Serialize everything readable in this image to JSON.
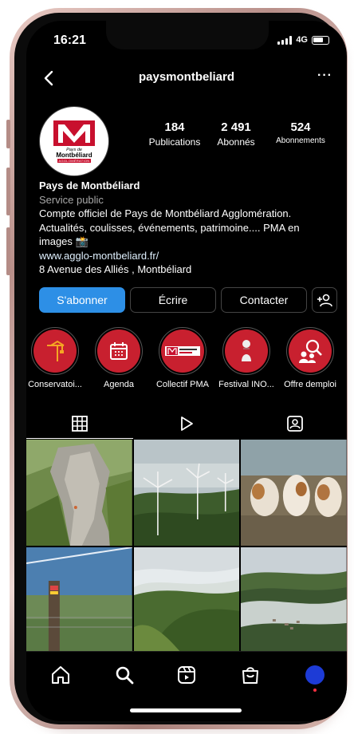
{
  "status": {
    "time": "16:21",
    "network": "4G"
  },
  "header": {
    "username": "paysmontbeliard",
    "more": "···"
  },
  "profile": {
    "logo": {
      "line1": "Pays de",
      "line2": "Montbéliard",
      "line3": "AGGLOMÉRATION"
    },
    "stats": [
      {
        "value": "184",
        "label": "Publications"
      },
      {
        "value": "2 491",
        "label": "Abonnés"
      },
      {
        "value": "524",
        "label": "Abonnements"
      }
    ],
    "name": "Pays de Montbéliard",
    "category": "Service public",
    "bio_line1": "Compte officiel de Pays de Montbéliard Agglomération.",
    "bio_line2": "Actualités, coulisses, événements, patrimoine.... PMA en",
    "bio_line3": "images 📸",
    "website": "www.agglo-montbeliard.fr/",
    "address": "8 Avenue des Alliés , Montbéliard"
  },
  "actions": {
    "subscribe": "S'abonner",
    "message": "Écrire",
    "contact": "Contacter"
  },
  "highlights": [
    {
      "label": "Conservatoi...",
      "icon": "crane-icon"
    },
    {
      "label": "Agenda",
      "icon": "calendar-icon"
    },
    {
      "label": "Collectif PMA",
      "icon": "pma-logo-icon"
    },
    {
      "label": "Festival INO...",
      "icon": "figure-icon"
    },
    {
      "label": "Offre demploi",
      "icon": "people-search-icon"
    }
  ],
  "tabs": [
    "grid-icon",
    "reels-icon",
    "tagged-icon"
  ],
  "posts": [
    {
      "subject": "rock-climber"
    },
    {
      "subject": "wind-turbines"
    },
    {
      "subject": "cows"
    },
    {
      "subject": "fence-post"
    },
    {
      "subject": "misty-forest"
    },
    {
      "subject": "foggy-village"
    }
  ],
  "colors": {
    "accent": "#2d8fe6",
    "brand_red": "#c8202f",
    "background": "#000000"
  }
}
